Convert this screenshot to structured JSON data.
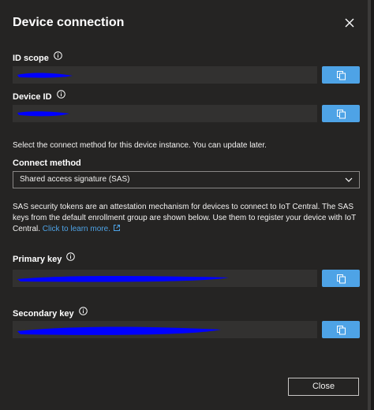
{
  "dialog": {
    "title": "Device connection",
    "close_label": "Close"
  },
  "id_scope": {
    "label": "ID scope",
    "value": ""
  },
  "device_id": {
    "label": "Device ID",
    "value": ""
  },
  "instructions": "Select the connect method for this device instance. You can update later.",
  "connect_method": {
    "label": "Connect method",
    "selected": "Shared access signature (SAS)"
  },
  "sas_description": "SAS security tokens are an attestation mechanism for devices to connect to IoT Central. The SAS keys from the default enrollment group are shown below. Use them to register your device with IoT Central.",
  "learn_more_link": "Click to learn more.",
  "primary_key": {
    "label": "Primary key",
    "value": ""
  },
  "secondary_key": {
    "label": "Secondary key",
    "value": ""
  },
  "colors": {
    "background": "#252423",
    "field_background": "#323130",
    "accent": "#4ea3e6",
    "redaction": "#0000ff",
    "text": "#ffffff"
  },
  "icons": {
    "dismiss": "close-icon",
    "info": "info-icon",
    "copy": "copy-icon",
    "dropdown": "chevron-down-icon",
    "external_link": "external-link-icon"
  }
}
